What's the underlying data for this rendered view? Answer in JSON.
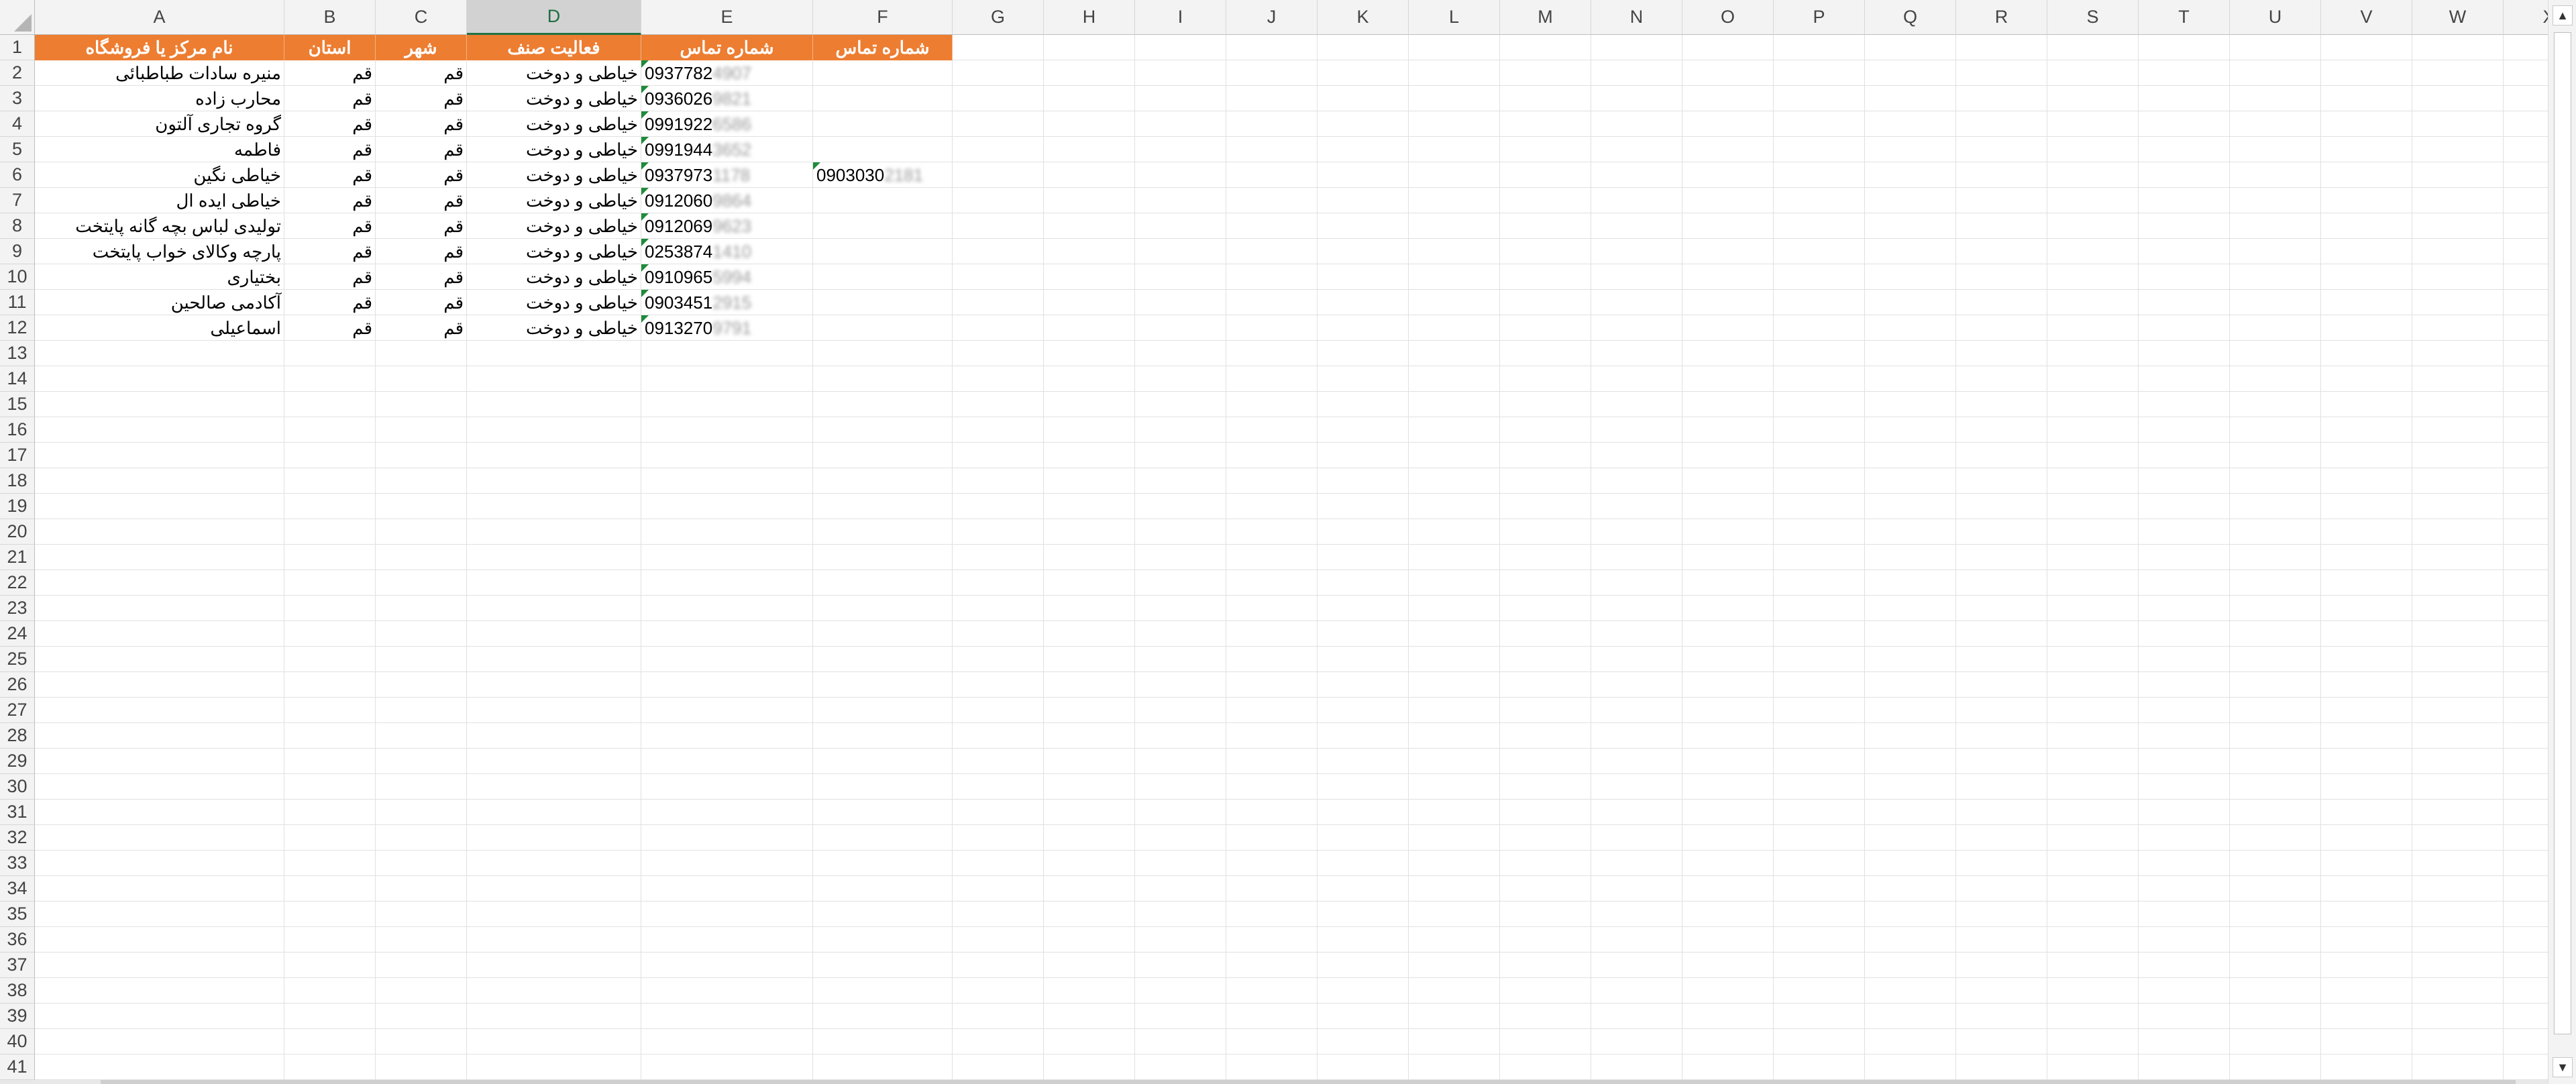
{
  "columns": [
    "A",
    "B",
    "C",
    "D",
    "E",
    "F",
    "G",
    "H",
    "I",
    "J",
    "K",
    "L",
    "M",
    "N",
    "O",
    "P",
    "Q",
    "R",
    "S",
    "T",
    "U",
    "V",
    "W",
    "X"
  ],
  "selected_column": "D",
  "row_numbers": [
    "1",
    "2",
    "3",
    "4",
    "5",
    "6",
    "7",
    "8",
    "9",
    "10",
    "11",
    "12",
    "13",
    "14",
    "15",
    "16",
    "17",
    "18",
    "19",
    "20",
    "21",
    "22",
    "23",
    "24",
    "25",
    "26",
    "27",
    "28",
    "29",
    "30",
    "31",
    "32",
    "33",
    "34",
    "35",
    "36",
    "37",
    "38",
    "39",
    "40",
    "41"
  ],
  "header_row": {
    "A": "نام مرکز یا فروشگاه",
    "B": "استان",
    "C": "شهر",
    "D": "فعالیت صنف",
    "E": "شماره تماس",
    "F": "شماره تماس"
  },
  "rows": [
    {
      "name": "منیره سادات طباطبائی",
      "province": "قم",
      "city": "قم",
      "activity": "خیاطی و دوخت",
      "phone": "0937782",
      "phone_hidden": "4907",
      "phone2": "",
      "phone2_hidden": ""
    },
    {
      "name": "محارب زاده",
      "province": "قم",
      "city": "قم",
      "activity": "خیاطی و دوخت",
      "phone": "0936026",
      "phone_hidden": "9821",
      "phone2": "",
      "phone2_hidden": ""
    },
    {
      "name": "گروه تجاری آلتون",
      "province": "قم",
      "city": "قم",
      "activity": "خیاطی و دوخت",
      "phone": "0991922",
      "phone_hidden": "6586",
      "phone2": "",
      "phone2_hidden": ""
    },
    {
      "name": "فاطمه",
      "province": "قم",
      "city": "قم",
      "activity": "خیاطی و دوخت",
      "phone": "0991944",
      "phone_hidden": "3652",
      "phone2": "",
      "phone2_hidden": ""
    },
    {
      "name": "خیاطی نگین",
      "province": "قم",
      "city": "قم",
      "activity": "خیاطی و دوخت",
      "phone": "0937973",
      "phone_hidden": "1178",
      "phone2": "0903030",
      "phone2_hidden": "2181"
    },
    {
      "name": "خیاطی ایده ال",
      "province": "قم",
      "city": "قم",
      "activity": "خیاطی و دوخت",
      "phone": "0912060",
      "phone_hidden": "9864",
      "phone2": "",
      "phone2_hidden": ""
    },
    {
      "name": "تولیدی لباس بچه گانه  پایتخت",
      "province": "قم",
      "city": "قم",
      "activity": "خیاطی و دوخت",
      "phone": "0912069",
      "phone_hidden": "9623",
      "phone2": "",
      "phone2_hidden": ""
    },
    {
      "name": "پارچه وکالای خواب پایتخت",
      "province": "قم",
      "city": "قم",
      "activity": "خیاطی و دوخت",
      "phone": "0253874",
      "phone_hidden": "1410",
      "phone2": "",
      "phone2_hidden": ""
    },
    {
      "name": "بختیاری",
      "province": "قم",
      "city": "قم",
      "activity": "خیاطی و دوخت",
      "phone": "0910965",
      "phone_hidden": "5994",
      "phone2": "",
      "phone2_hidden": ""
    },
    {
      "name": "آکادمی صالحین",
      "province": "قم",
      "city": "قم",
      "activity": "خیاطی و دوخت",
      "phone": "0903451",
      "phone_hidden": "2915",
      "phone2": "",
      "phone2_hidden": ""
    },
    {
      "name": "اسماعیلی",
      "province": "قم",
      "city": "قم",
      "activity": "خیاطی و دوخت",
      "phone": "0913270",
      "phone_hidden": "9791",
      "phone2": "",
      "phone2_hidden": ""
    }
  ],
  "colors": {
    "header_fill": "#ed7d31",
    "header_text": "#ffffff",
    "selected_col_accent": "#217346",
    "flag": "#1e8b3a"
  },
  "icons": {
    "scroll_up": "triangle-up-icon",
    "scroll_down": "triangle-down-icon"
  }
}
